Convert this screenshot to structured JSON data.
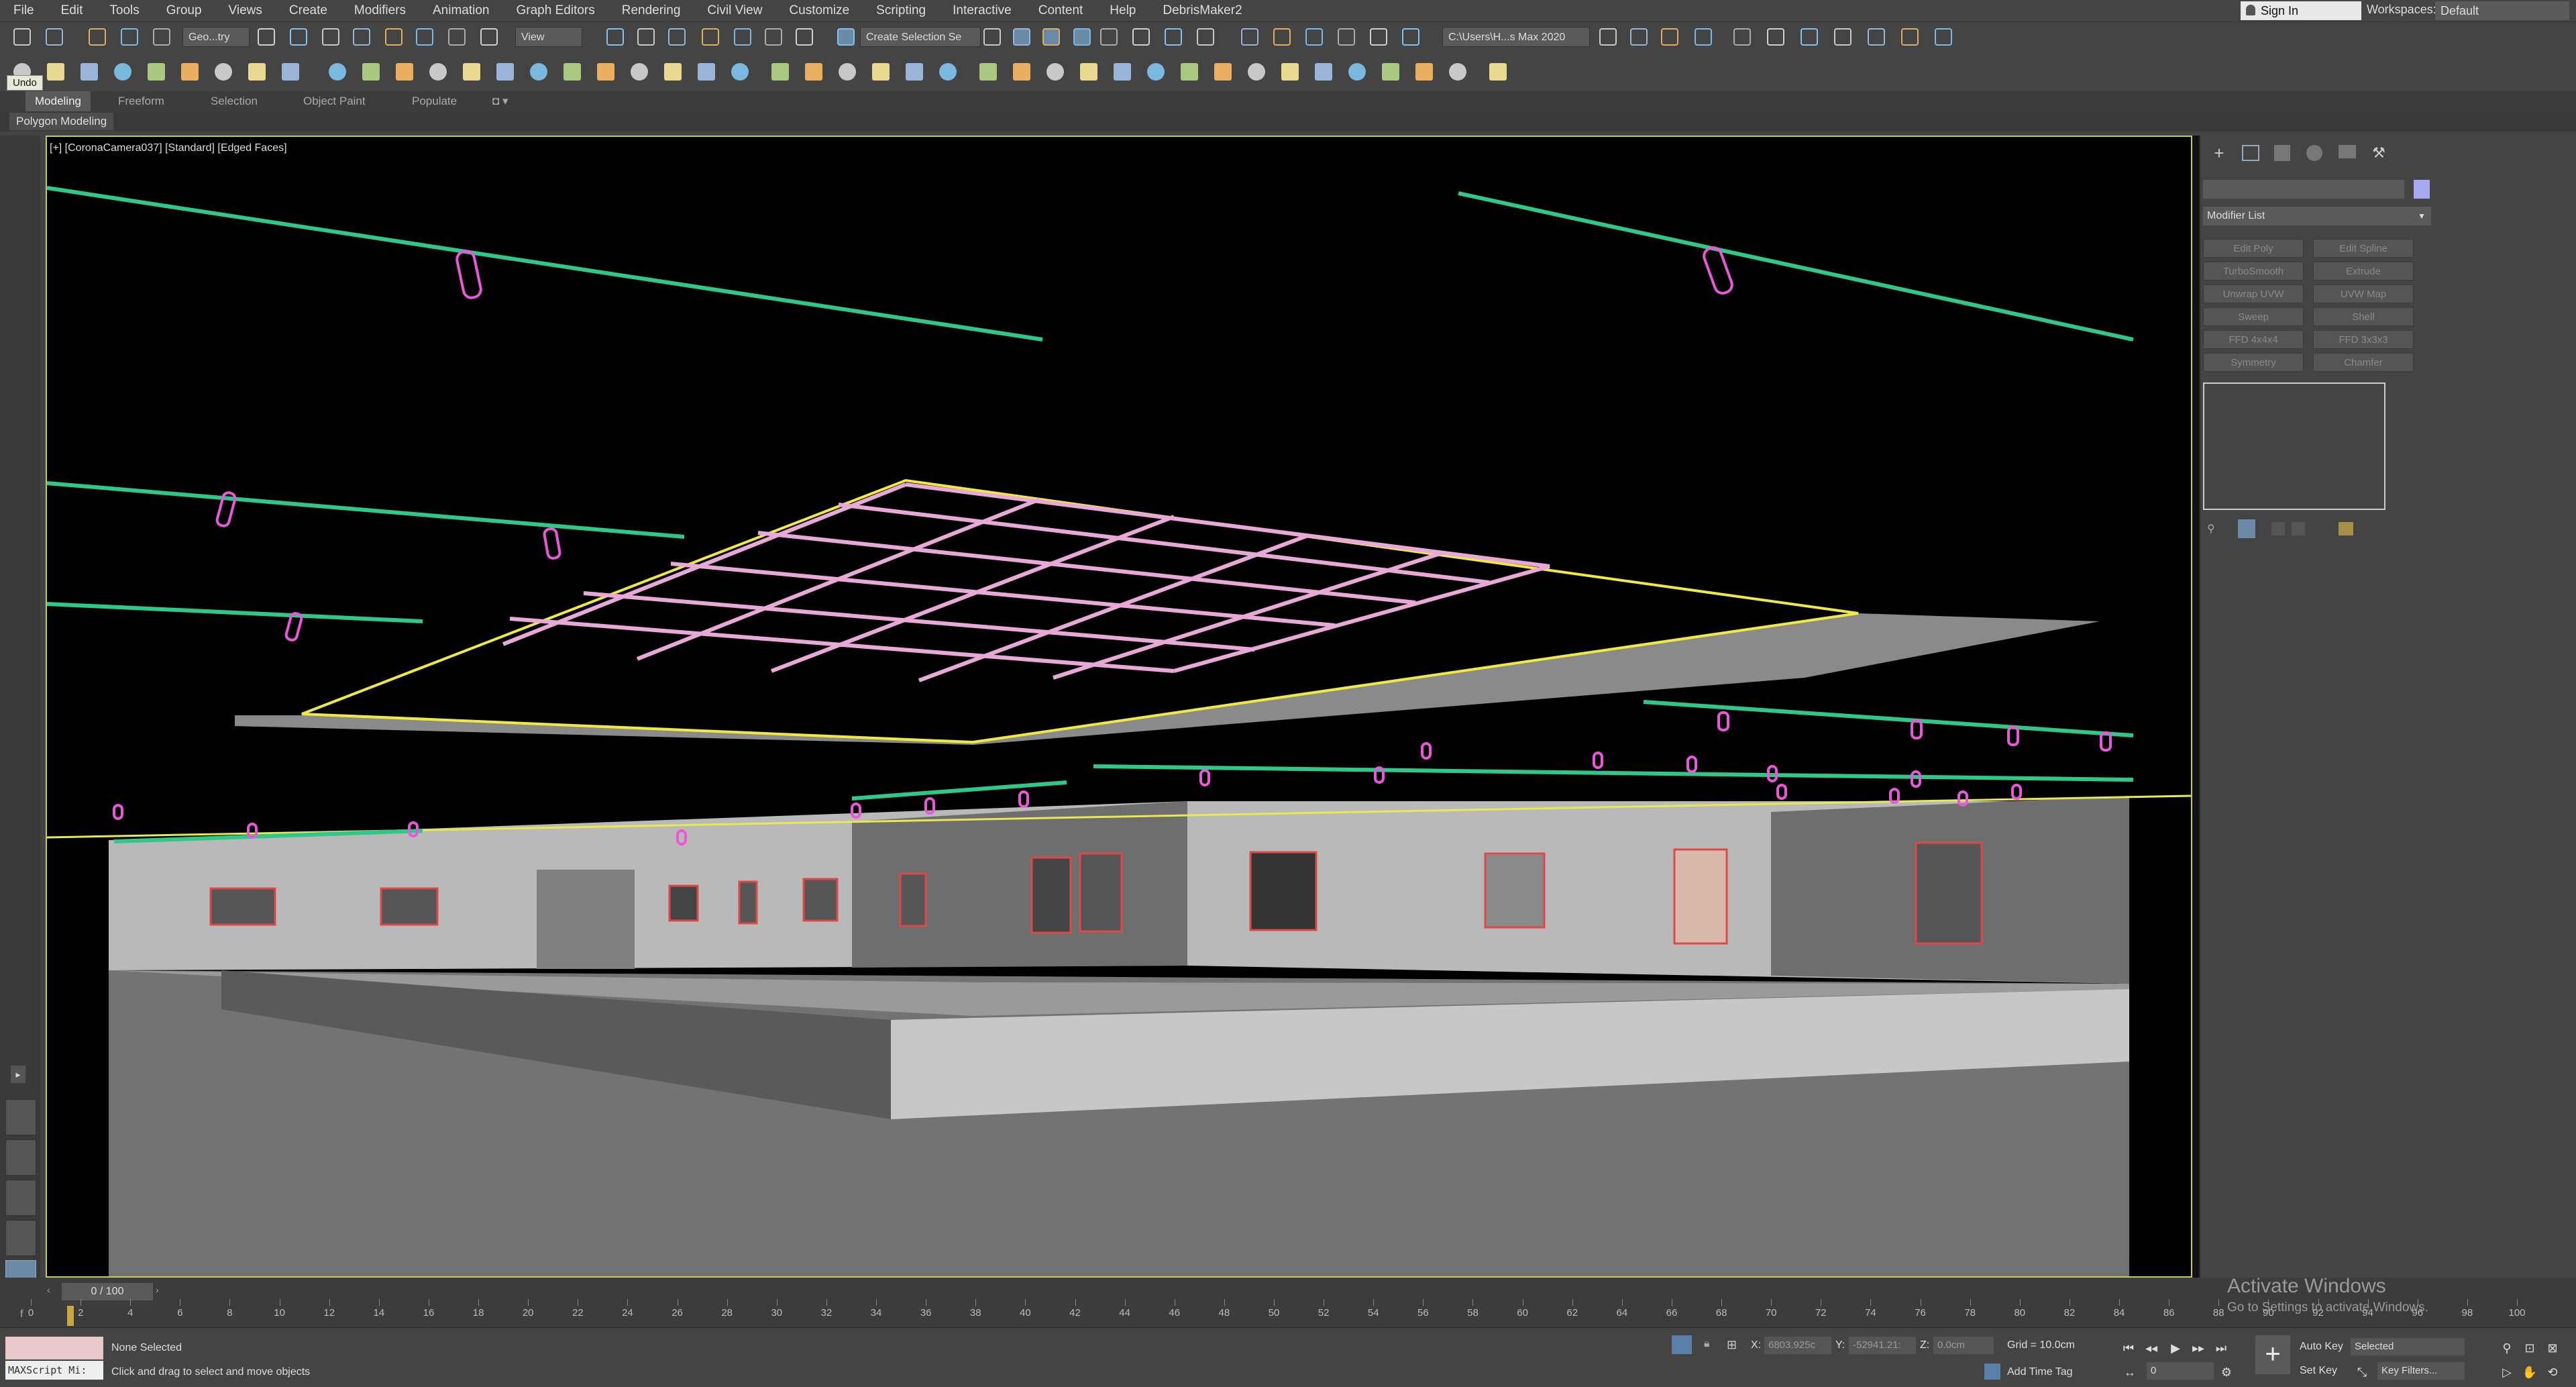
{
  "menu": [
    "File",
    "Edit",
    "Tools",
    "Group",
    "Views",
    "Create",
    "Modifiers",
    "Animation",
    "Graph Editors",
    "Rendering",
    "Civil View",
    "Customize",
    "Scripting",
    "Interactive",
    "Content",
    "Help",
    "DebrisMaker2"
  ],
  "signin": "Sign In",
  "workspaces_label": "Workspaces:",
  "workspace": "Default",
  "toolbar": {
    "geometry_filter": "Geo...try",
    "ref_coord": "View",
    "selection_set": "Create Selection Se",
    "project_path": "C:\\Users\\H...s Max 2020"
  },
  "undo_tooltip": "Undo",
  "ribbon": {
    "tabs": [
      "Modeling",
      "Freeform",
      "Selection",
      "Object Paint",
      "Populate"
    ],
    "panel": "Polygon Modeling"
  },
  "viewport": {
    "label": "[+] [CoronaCamera037] [Standard] [Edged Faces]"
  },
  "command_panel": {
    "modifier_list": "Modifier List",
    "modifier_buttons": [
      "Edit Poly",
      "Edit Spline",
      "TurboSmooth",
      "Extrude",
      "Unwrap UVW",
      "UVW Map",
      "Sweep",
      "Shell",
      "FFD 4x4x4",
      "FFD 3x3x3",
      "Symmetry",
      "Chamfer"
    ]
  },
  "timeline": {
    "frame_counter": "0 / 100",
    "ticks": [
      "0",
      "2",
      "4",
      "6",
      "8",
      "10",
      "12",
      "14",
      "16",
      "18",
      "20",
      "22",
      "24",
      "26",
      "28",
      "30",
      "32",
      "34",
      "36",
      "38",
      "40",
      "42",
      "44",
      "46",
      "48",
      "50",
      "52",
      "54",
      "56",
      "58",
      "60",
      "62",
      "64",
      "66",
      "68",
      "70",
      "72",
      "74",
      "76",
      "78",
      "80",
      "82",
      "84",
      "86",
      "88",
      "90",
      "92",
      "94",
      "96",
      "98",
      "100"
    ]
  },
  "status": {
    "maxscript": "MAXScript Mi:",
    "selection": "None Selected",
    "prompt": "Click and drag to select and move objects",
    "x_label": "X:",
    "x_value": "6803.925c",
    "y_label": "Y:",
    "y_value": "-52941.21:",
    "z_label": "Z:",
    "z_value": "0.0cm",
    "grid": "Grid = 10.0cm",
    "add_time_tag": "Add Time Tag",
    "auto_key": "Auto Key",
    "set_key": "Set Key",
    "key_mode": "Selected",
    "key_filters": "Key Filters...",
    "frame": "0"
  },
  "activate_windows": {
    "title": "Activate Windows",
    "subtitle": "Go to Settings to activate Windows."
  }
}
